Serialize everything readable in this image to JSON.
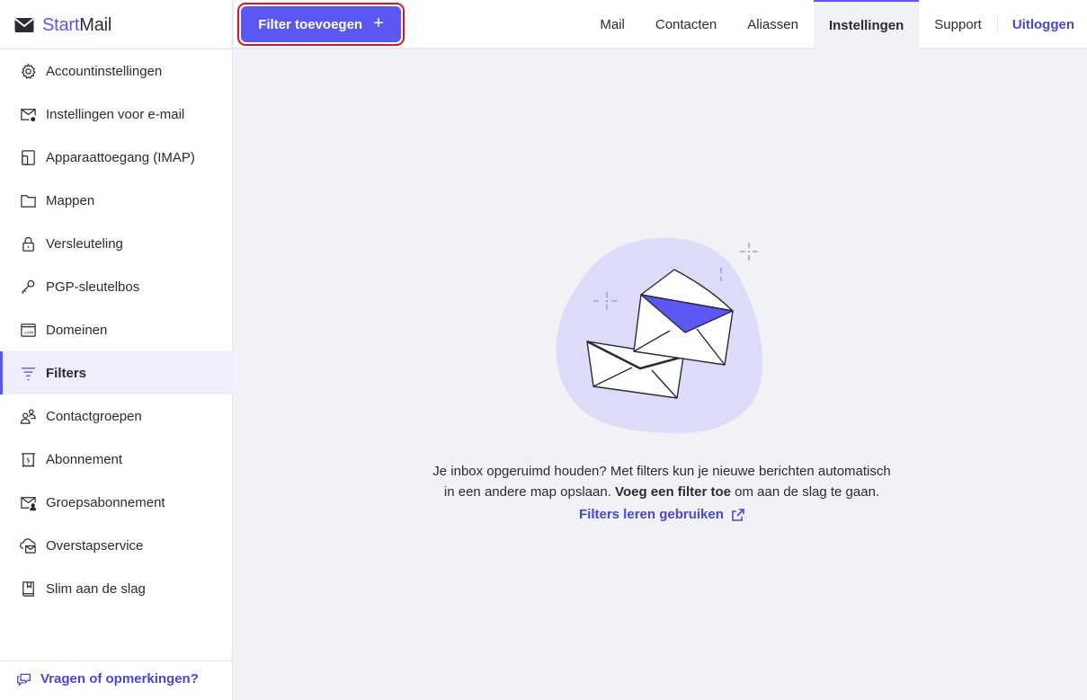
{
  "app": {
    "logo_part1": "Start",
    "logo_part2": "Mail"
  },
  "header": {
    "add_filter_label": "Filter toevoegen",
    "add_filter_plus": "+",
    "tabs": [
      {
        "label": "Mail"
      },
      {
        "label": "Contacten"
      },
      {
        "label": "Aliassen"
      },
      {
        "label": "Instellingen",
        "active": true
      },
      {
        "label": "Support"
      }
    ],
    "logout_label": "Uitloggen"
  },
  "sidebar": {
    "items": [
      {
        "label": "Accountinstellingen",
        "icon": "gear-icon"
      },
      {
        "label": "Instellingen voor e-mail",
        "icon": "mail-settings-icon"
      },
      {
        "label": "Apparaattoegang (IMAP)",
        "icon": "device-icon"
      },
      {
        "label": "Mappen",
        "icon": "folder-icon"
      },
      {
        "label": "Versleuteling",
        "icon": "lock-icon"
      },
      {
        "label": "PGP-sleutelbos",
        "icon": "key-icon"
      },
      {
        "label": "Domeinen",
        "icon": "domain-icon",
        "icon_text": ".com"
      },
      {
        "label": "Filters",
        "icon": "filter-icon",
        "active": true
      },
      {
        "label": "Contactgroepen",
        "icon": "contact-group-icon"
      },
      {
        "label": "Abonnement",
        "icon": "receipt-icon"
      },
      {
        "label": "Groepsabonnement",
        "icon": "group-subscription-icon"
      },
      {
        "label": "Overstapservice",
        "icon": "cloud-mail-icon"
      },
      {
        "label": "Slim aan de slag",
        "icon": "book-icon"
      }
    ],
    "feedback_label": "Vragen of opmerkingen?"
  },
  "main": {
    "empty_line1": "Je inbox opgeruimd houden? Met filters kun je nieuwe berichten automatisch",
    "empty_line2_prefix": "in een andere map opslaan. ",
    "empty_line2_bold": "Voeg een filter toe",
    "empty_line2_suffix": " om aan de slag te gaan.",
    "learn_link": "Filters leren gebruiken"
  },
  "colors": {
    "accent": "#5a57f2",
    "link": "#4a47d6",
    "highlight_border": "#e4101e",
    "blob": "#dcdcf8"
  }
}
